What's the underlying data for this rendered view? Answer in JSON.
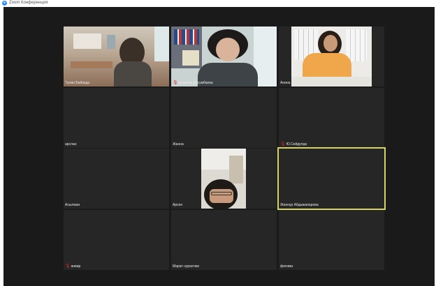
{
  "app": {
    "title": "Zoom Конференция"
  },
  "participants": [
    {
      "name": "Талап Байзида",
      "muted": false,
      "video": true
    },
    {
      "name": "Анарбек Досумбаева",
      "muted": true,
      "video": true
    },
    {
      "name": "Анина",
      "muted": false,
      "video": true
    },
    {
      "name": "арслан",
      "muted": false,
      "video": false
    },
    {
      "name": "Жанна",
      "muted": false,
      "video": false
    },
    {
      "name": "Ю.Сейдулда",
      "muted": true,
      "video": false
    },
    {
      "name": "Асылжан",
      "muted": false,
      "video": false
    },
    {
      "name": "Арсен",
      "muted": false,
      "video": true
    },
    {
      "name": "Жаннур Абдыжапарова",
      "muted": false,
      "video": false,
      "active_speaker": true
    },
    {
      "name": "анвар",
      "muted": true,
      "video": false
    },
    {
      "name": "Марат нурахтам",
      "muted": false,
      "video": false
    },
    {
      "name": "фатима",
      "muted": false,
      "video": false
    }
  ],
  "icons": {
    "mic_muted": "mic-off-icon",
    "app_logo": "zoom-logo-icon"
  },
  "colors": {
    "stage": "#1a1a1a",
    "tile": "#262626",
    "active_border": "#d7d466",
    "muted_mic": "#e02828"
  }
}
